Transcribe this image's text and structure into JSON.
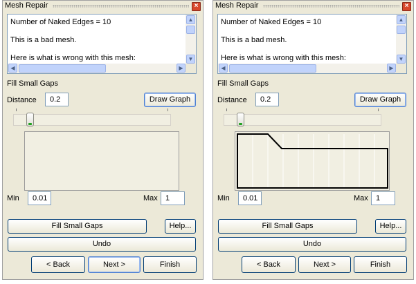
{
  "panels": [
    {
      "title": "Mesh Repair",
      "close_glyph": "×",
      "report_lines": [
        "Number of Naked Edges = 10",
        "This is a bad mesh.",
        "Here is what is wrong with this mesh:"
      ],
      "section_label": "Fill Small Gaps",
      "distance_label": "Distance",
      "distance_value": "0.2",
      "draw_graph_label": "Draw Graph",
      "graph_drawn": false,
      "min_label": "Min",
      "min_value": "0.01",
      "max_label": "Max",
      "max_value": "1",
      "fill_label": "Fill Small Gaps",
      "help_label": "Help...",
      "undo_label": "Undo",
      "back_label": "< Back",
      "next_label": "Next >",
      "finish_label": "Finish"
    },
    {
      "title": "Mesh Repair",
      "close_glyph": "×",
      "report_lines": [
        "Number of Naked Edges = 10",
        "This is a bad mesh.",
        "Here is what is wrong with this mesh:"
      ],
      "section_label": "Fill Small Gaps",
      "distance_label": "Distance",
      "distance_value": "0.2",
      "draw_graph_label": "Draw Graph",
      "graph_drawn": true,
      "min_label": "Min",
      "min_value": "0.01",
      "max_label": "Max",
      "max_value": "1",
      "fill_label": "Fill Small Gaps",
      "help_label": "Help...",
      "undo_label": "Undo",
      "back_label": "< Back",
      "next_label": "Next >",
      "finish_label": "Finish"
    }
  ]
}
